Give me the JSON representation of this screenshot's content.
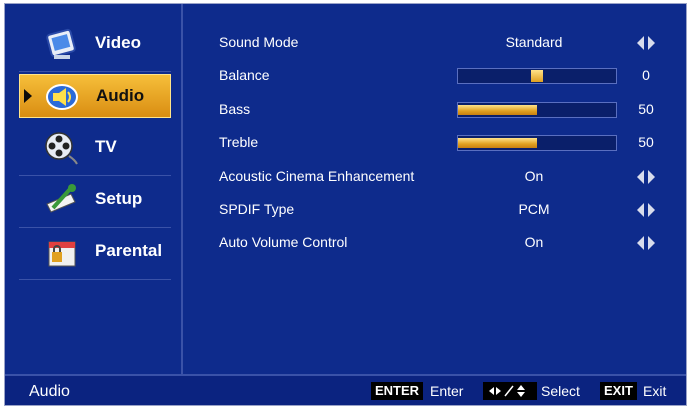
{
  "colors": {
    "background": "#0e2b8c",
    "highlight": "#f0b030",
    "bar_fill": "#e0a020",
    "text": "#ffffff"
  },
  "sidebar": {
    "items": [
      {
        "label": "Video",
        "icon": "video-icon",
        "selected": false
      },
      {
        "label": "Audio",
        "icon": "audio-speaker-icon",
        "selected": true
      },
      {
        "label": "TV",
        "icon": "tv-film-reel-icon",
        "selected": false
      },
      {
        "label": "Setup",
        "icon": "setup-wrench-icon",
        "selected": false
      },
      {
        "label": "Parental",
        "icon": "parental-lock-icon",
        "selected": false
      }
    ]
  },
  "settings": [
    {
      "name": "Sound Mode",
      "type": "select",
      "value": "Standard"
    },
    {
      "name": "Balance",
      "type": "slider",
      "value": "0",
      "level": 0,
      "min": -50,
      "max": 50
    },
    {
      "name": "Bass",
      "type": "bar",
      "value": "50",
      "level": 50,
      "max": 100
    },
    {
      "name": "Treble",
      "type": "bar",
      "value": "50",
      "level": 50,
      "max": 100
    },
    {
      "name": "Acoustic Cinema Enhancement",
      "type": "select",
      "value": "On"
    },
    {
      "name": "SPDIF Type",
      "type": "select",
      "value": "PCM"
    },
    {
      "name": "Auto Volume Control",
      "type": "select",
      "value": "On"
    }
  ],
  "status": {
    "title": "Audio",
    "enter_key": "ENTER",
    "enter_text": "Enter",
    "select_text": "Select",
    "exit_key": "EXIT",
    "exit_text": "Exit"
  }
}
